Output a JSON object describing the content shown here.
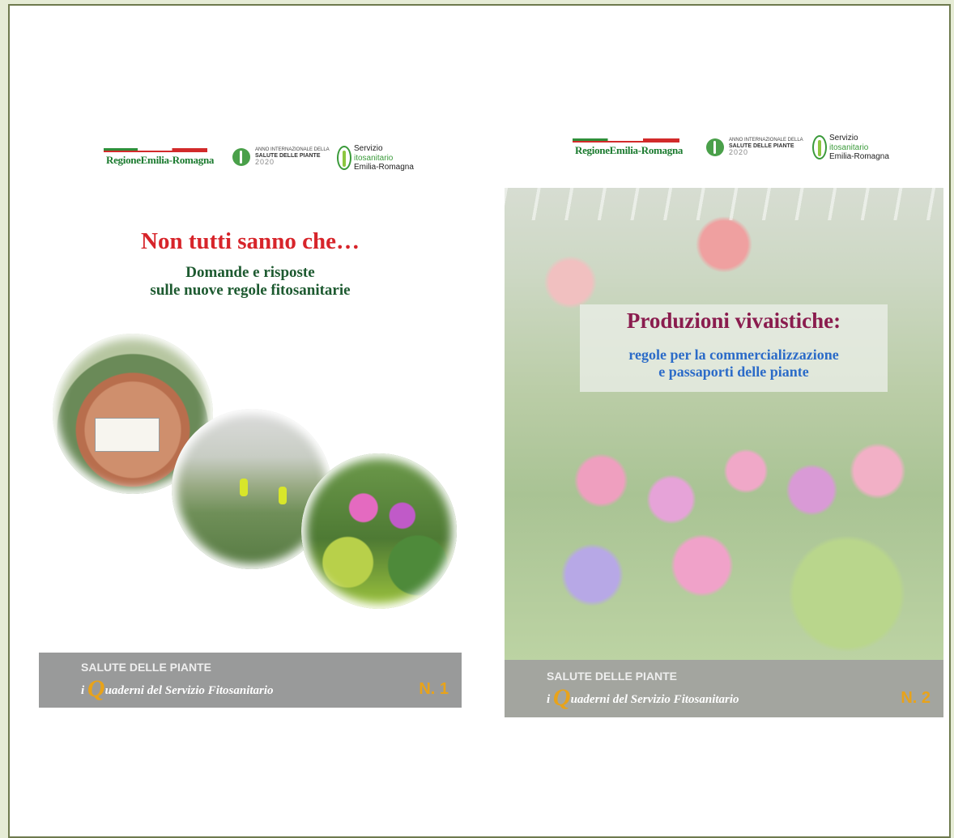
{
  "logos": {
    "regione": "RegioneEmilia-Romagna",
    "anno_line1": "ANNO INTERNAZIONALE DELLA",
    "anno_line2": "SALUTE DELLE PIANTE",
    "anno_year": "2020",
    "servizio_line1": "Servizio",
    "servizio_line2": "itosanitario",
    "servizio_line3": "Emilia-Romagna"
  },
  "cover1": {
    "title": "Non tutti sanno che…",
    "subtitle_line1": "Domande e risposte",
    "subtitle_line2": "sulle nuove regole fitosanitarie",
    "category": "SALUTE DELLE PIANTE",
    "series_prefix": "i",
    "series_q": "Q",
    "series_rest": "uaderni del Servizio Fitosanitario",
    "number": "N. 1"
  },
  "cover2": {
    "title": "Produzioni vivaistiche:",
    "subtitle_line1": "regole per la commercializzazione",
    "subtitle_line2": "e passaporti delle piante",
    "category": "SALUTE DELLE PIANTE",
    "series_prefix": "i",
    "series_q": "Q",
    "series_rest": "uaderni del Servizio Fitosanitario",
    "number": "N. 2"
  },
  "colors": {
    "accent_red": "#d7242a",
    "title_green": "#1d5a30",
    "title_magenta": "#8a1c4e",
    "subtitle_blue": "#2b6bc8",
    "number_orange": "#e8a31a",
    "band_gray": "#999a9a"
  }
}
